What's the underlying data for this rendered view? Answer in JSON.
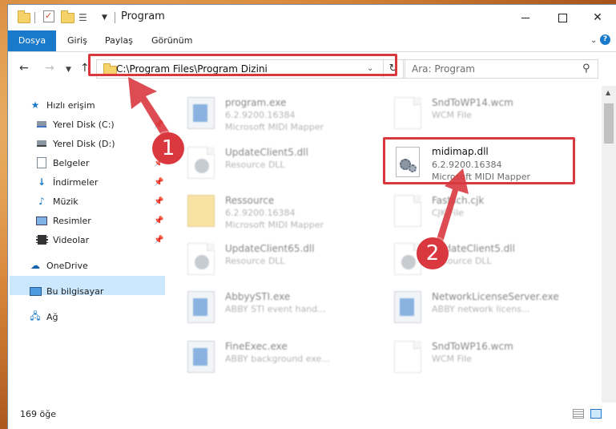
{
  "window": {
    "title": "Program"
  },
  "ribbon": {
    "tabs": [
      "Dosya",
      "Giriş",
      "Paylaş",
      "Görünüm"
    ]
  },
  "address": {
    "path": "C:\\Program Files\\Program Dizini"
  },
  "search": {
    "placeholder": "Ara: Program"
  },
  "navpane": {
    "items": [
      {
        "label": "Hızlı erişim",
        "icon": "star-icon"
      },
      {
        "label": "Yerel Disk (C:)",
        "icon": "drive-icon"
      },
      {
        "label": "Yerel Disk (D:)",
        "icon": "drive-icon"
      },
      {
        "label": "Belgeler",
        "icon": "documents-icon"
      },
      {
        "label": "İndirmeler",
        "icon": "download-icon"
      },
      {
        "label": "Müzik",
        "icon": "music-icon"
      },
      {
        "label": "Resimler",
        "icon": "pictures-icon"
      },
      {
        "label": "Videolar",
        "icon": "videos-icon"
      },
      {
        "label": "OneDrive",
        "icon": "cloud-icon"
      },
      {
        "label": "Bu bilgisayar",
        "icon": "computer-icon"
      },
      {
        "label": "Ağ",
        "icon": "network-icon"
      }
    ]
  },
  "files": [
    {
      "name": "program.exe",
      "line1": "6.2.9200.16384",
      "line2": "Microsoft MIDI Mapper"
    },
    {
      "name": "SndToWP14.wcm",
      "line1": "WCM File",
      "line2": ""
    },
    {
      "name": "UpdateClient5.dll",
      "line1": "Resource DLL",
      "line2": ""
    },
    {
      "name": "Ressource",
      "line1": "6.2.9200.16384",
      "line2": "Microsoft MIDI Mapper"
    },
    {
      "name": "Fastsch.cjk",
      "line1": "CJK File",
      "line2": ""
    },
    {
      "name": "UpdateClient65.dll",
      "line1": "Resource DLL",
      "line2": ""
    },
    {
      "name": "UpdateClient5.dll",
      "line1": "Resource DLL",
      "line2": ""
    },
    {
      "name": "AbbyySTI.exe",
      "line1": "ABBY STI event hand...",
      "line2": ""
    },
    {
      "name": "NetworkLicenseServer.exe",
      "line1": "ABBY network licens...",
      "line2": ""
    },
    {
      "name": "FineExec.exe",
      "line1": "ABBY background exe...",
      "line2": ""
    },
    {
      "name": "SndToWP16.wcm",
      "line1": "WCM File",
      "line2": ""
    }
  ],
  "focused_file": {
    "name": "midimap.dll",
    "line1": "6.2.9200.16384",
    "line2": "Microsoft MIDI Mapper"
  },
  "callouts": {
    "one": "1",
    "two": "2"
  },
  "status": {
    "count": "169 öğe"
  },
  "colors": {
    "accent": "#1979ca",
    "highlight": "#d9383f",
    "selected": "#cce8ff"
  }
}
